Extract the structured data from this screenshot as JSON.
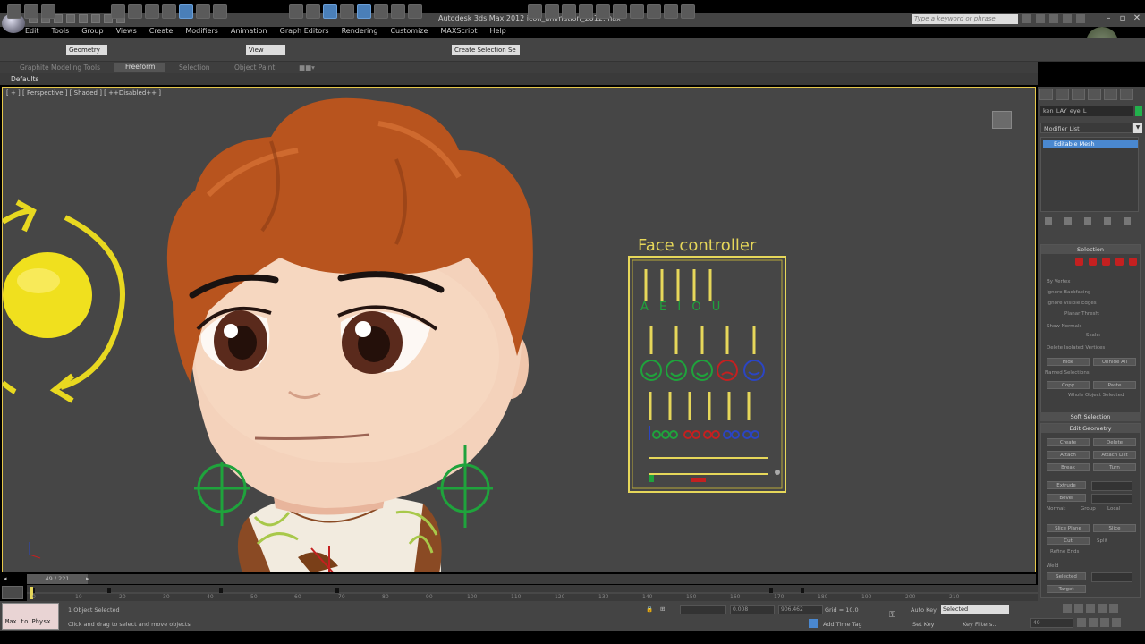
{
  "window": {
    "title": "Autodesk 3ds Max 2012    icon_animation_2012.max",
    "search_placeholder": "Type a keyword or phrase"
  },
  "menu": [
    "Edit",
    "Tools",
    "Group",
    "Views",
    "Create",
    "Modifiers",
    "Animation",
    "Graph Editors",
    "Rendering",
    "Customize",
    "MAXScript",
    "Help"
  ],
  "toolbar": {
    "selection_filter": "Geometry",
    "reference_coord": "View",
    "named_selection": "Create Selection Se"
  },
  "ribbon": {
    "tabs": [
      "Graphite Modeling Tools",
      "Freeform",
      "Selection",
      "Object Paint"
    ],
    "active_tab": "Freeform",
    "subpanel": "Defaults"
  },
  "viewport": {
    "label": "[ + ] [ Perspective ] [ Shaded ] [ ++Disabled++ ]",
    "face_controller_label": "Face controller",
    "vowels": "A E I O U"
  },
  "command_panel": {
    "object_name": "ken_LAY_eye_L",
    "modifier_list": "Modifier List",
    "stack_item": "Editable Mesh",
    "selection_title": "Selection",
    "by_vertex": "By Vertex",
    "ignore_backfacing": "Ignore Backfacing",
    "ignore_visible_edges": "Ignore Visible Edges",
    "planar_thresh": "Planar Thresh:",
    "show_normals": "Show Normals",
    "scale": "Scale:",
    "delete_isolated": "Delete Isolated Vertices",
    "hide_btn": "Hide",
    "unhide_all_btn": "Unhide All",
    "named_selections": "Named Selections:",
    "copy_btn": "Copy",
    "paste_btn": "Paste",
    "whole_object": "Whole Object Selected",
    "soft_selection": "Soft Selection",
    "edit_geometry": "Edit Geometry",
    "create_btn": "Create",
    "delete_btn": "Delete",
    "attach_btn": "Attach",
    "attach_list_btn": "Attach List",
    "break_btn": "Break",
    "turn_btn": "Turn",
    "extrude_btn": "Extrude",
    "bevel_btn": "Bevel",
    "normal_label": "Normal:",
    "group_label": "Group",
    "local_label": "Local",
    "slice_plane_btn": "Slice Plane",
    "slice_btn": "Slice",
    "cut_btn": "Cut",
    "split_label": "Split",
    "refine_ends": "Refine Ends",
    "weld_label": "Weld",
    "selected_btn": "Selected",
    "target_btn": "Target"
  },
  "timeline": {
    "slider_label": "49 / 221",
    "ticks": [
      "0",
      "10",
      "20",
      "30",
      "40",
      "50",
      "60",
      "70",
      "80",
      "90",
      "100",
      "110",
      "120",
      "130",
      "140",
      "150",
      "160",
      "170",
      "180",
      "190",
      "200",
      "210"
    ]
  },
  "status": {
    "maxscript": "Max to Physx",
    "objects_selected": "1 Object Selected",
    "prompt": "Click and drag to select and move objects",
    "x_field": "0.008",
    "y_field": "906.462",
    "grid": "Grid = 10.0",
    "auto_key": "Auto Key",
    "set_key": "Set Key",
    "selected": "Selected",
    "key_filters": "Key Filters...",
    "add_time_tag": "Add Time Tag",
    "frame": "49"
  },
  "colors": {
    "viewport_bg": "#464646",
    "viewport_border": "#e6c84a",
    "controller_yellow": "#e6d75a",
    "green": "#1fa33c",
    "red": "#c42020",
    "blue": "#2b45c4",
    "hair": "#b8541e",
    "skin": "#f2cdb4"
  }
}
